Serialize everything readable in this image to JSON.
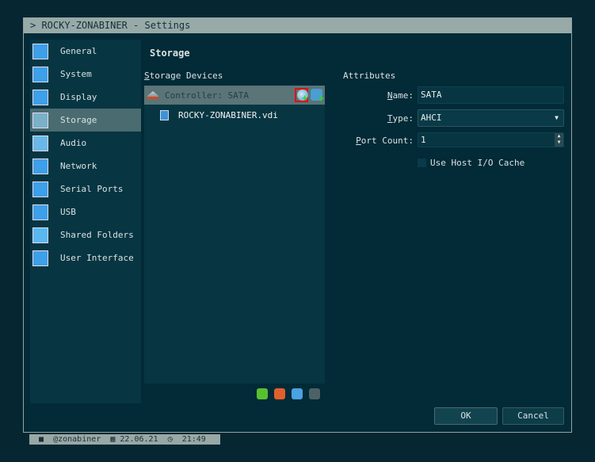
{
  "window": {
    "title": "> ROCKY-ZONABINER - Settings"
  },
  "sidebar": {
    "items": [
      {
        "label": "General",
        "icon": "monitor-icon"
      },
      {
        "label": "System",
        "icon": "chip-icon"
      },
      {
        "label": "Display",
        "icon": "display-icon"
      },
      {
        "label": "Storage",
        "icon": "disk-icon",
        "selected": true
      },
      {
        "label": "Audio",
        "icon": "speaker-icon"
      },
      {
        "label": "Network",
        "icon": "network-icon"
      },
      {
        "label": "Serial Ports",
        "icon": "serial-port-icon"
      },
      {
        "label": "USB",
        "icon": "usb-icon"
      },
      {
        "label": "Shared Folders",
        "icon": "folder-icon"
      },
      {
        "label": "User Interface",
        "icon": "window-icon"
      }
    ]
  },
  "page": {
    "title": "Storage",
    "devices_label_u": "S",
    "devices_label_rest": "torage Devices",
    "controller": "Controller: SATA",
    "disk": "ROCKY-ZONABINER.vdi"
  },
  "attributes": {
    "heading": "Attributes",
    "name_u": "N",
    "name_rest": "ame:",
    "name_value": "SATA",
    "type_u": "T",
    "type_rest": "ype:",
    "type_value": "AHCI",
    "port_u": "P",
    "port_rest": "ort Count:",
    "port_value": "1",
    "cache_label": "Use Host I/O Cache"
  },
  "buttons": {
    "ok": "OK",
    "cancel": "Cancel"
  },
  "statusbar": {
    "user": "@zonabiner",
    "date": "22.06.21",
    "time": "21:49"
  }
}
